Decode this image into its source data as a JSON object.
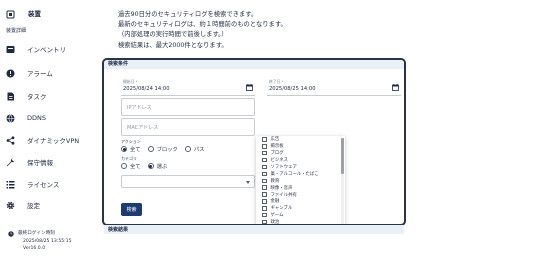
{
  "sidebar": {
    "top_label": "装置",
    "sub_label": "装置詳細",
    "items": [
      {
        "label": "インベントリ",
        "icon": "inventory-icon"
      },
      {
        "label": "アラーム",
        "icon": "alarm-icon"
      },
      {
        "label": "タスク",
        "icon": "task-icon"
      },
      {
        "label": "DDNS",
        "icon": "globe-icon"
      },
      {
        "label": "ダイナミックVPN",
        "icon": "share-icon"
      },
      {
        "label": "保守情報",
        "icon": "wrench-icon"
      },
      {
        "label": "ライセンス",
        "icon": "list-icon"
      },
      {
        "label": "設定",
        "icon": "gear-icon"
      }
    ],
    "footer": {
      "last_login_label": "最終ログイン時刻",
      "last_login_time": "2025/08/25 13:55:15",
      "version": "Ver16.0.0"
    }
  },
  "description": {
    "line1": "過去90日分のセキュリティログを検索できます。",
    "line2": "最新のセキュリティログは、約１時間前のものとなります。",
    "line3": "（内部処理の実行時間で前後します。）",
    "line4": "検索結果は、最大2000件となります。"
  },
  "search": {
    "header": "検索条件",
    "start_label": "開始日 *",
    "start_value": "2025/08/24 14:00",
    "end_label": "終了日 *",
    "end_value": "2025/08/25 14:00",
    "ip_placeholder": "IPアドレス",
    "mac_placeholder": "MACアドレス",
    "action_label": "アクション",
    "action_options": [
      "全て",
      "ブロック",
      "パス"
    ],
    "action_selected": 0,
    "category_label": "カテゴリ",
    "category_options": [
      "全て",
      "選ぶ"
    ],
    "category_selected": 1,
    "search_button": "検索",
    "next_section": "検索結果"
  },
  "category_list": [
    "広告",
    "掲示板",
    "ブログ",
    "ビジネス",
    "ソフトウェア",
    "薬・アルコール・たばこ",
    "教育",
    "映像・音声",
    "ファイル共有",
    "金融",
    "ギャンブル",
    "ゲーム",
    "政治"
  ],
  "colors": {
    "primary": "#1c3b73",
    "header_bg": "#e9f0f8",
    "text": "#1f2a44"
  }
}
